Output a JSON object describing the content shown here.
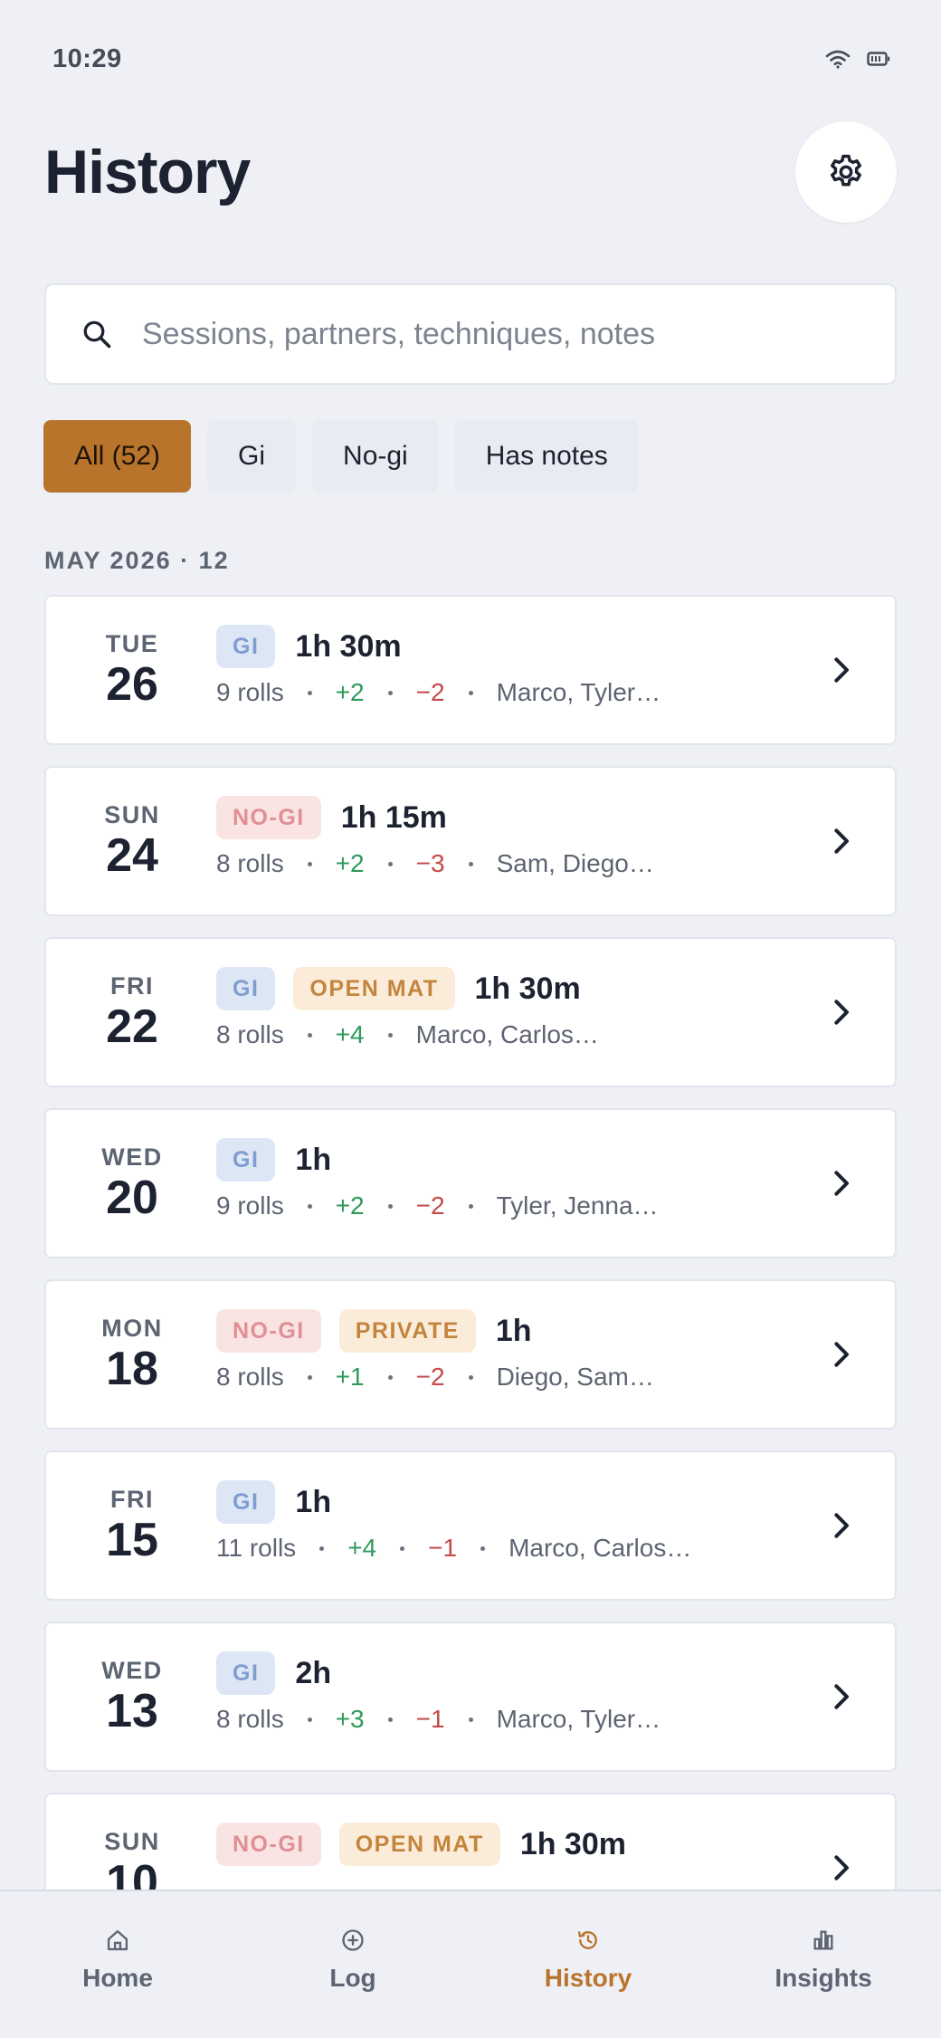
{
  "status": {
    "time": "10:29"
  },
  "header": {
    "title": "History"
  },
  "search": {
    "placeholder": "Sessions, partners, techniques, notes"
  },
  "filters": [
    {
      "label": "All (52)",
      "active": true
    },
    {
      "label": "Gi",
      "active": false
    },
    {
      "label": "No-gi",
      "active": false
    },
    {
      "label": "Has notes",
      "active": false
    }
  ],
  "section": {
    "label": "MAY 2026 · 12"
  },
  "sessions": [
    {
      "dow": "TUE",
      "day": "26",
      "tags": [
        {
          "text": "GI",
          "type": "gi"
        }
      ],
      "duration": "1h 30m",
      "rolls": "9 rolls",
      "wins": "+2",
      "losses": "−2",
      "partners": "Marco, Tyler…"
    },
    {
      "dow": "SUN",
      "day": "24",
      "tags": [
        {
          "text": "NO-GI",
          "type": "nogi"
        }
      ],
      "duration": "1h 15m",
      "rolls": "8 rolls",
      "wins": "+2",
      "losses": "−3",
      "partners": "Sam, Diego…"
    },
    {
      "dow": "FRI",
      "day": "22",
      "tags": [
        {
          "text": "GI",
          "type": "gi"
        },
        {
          "text": "OPEN MAT",
          "type": "open"
        }
      ],
      "duration": "1h 30m",
      "rolls": "8 rolls",
      "wins": "+4",
      "losses": "",
      "partners": "Marco, Carlos…"
    },
    {
      "dow": "WED",
      "day": "20",
      "tags": [
        {
          "text": "GI",
          "type": "gi"
        }
      ],
      "duration": "1h",
      "rolls": "9 rolls",
      "wins": "+2",
      "losses": "−2",
      "partners": "Tyler, Jenna…"
    },
    {
      "dow": "MON",
      "day": "18",
      "tags": [
        {
          "text": "NO-GI",
          "type": "nogi"
        },
        {
          "text": "PRIVATE",
          "type": "private"
        }
      ],
      "duration": "1h",
      "rolls": "8 rolls",
      "wins": "+1",
      "losses": "−2",
      "partners": "Diego, Sam…"
    },
    {
      "dow": "FRI",
      "day": "15",
      "tags": [
        {
          "text": "GI",
          "type": "gi"
        }
      ],
      "duration": "1h",
      "rolls": "11 rolls",
      "wins": "+4",
      "losses": "−1",
      "partners": "Marco, Carlos…"
    },
    {
      "dow": "WED",
      "day": "13",
      "tags": [
        {
          "text": "GI",
          "type": "gi"
        }
      ],
      "duration": "2h",
      "rolls": "8 rolls",
      "wins": "+3",
      "losses": "−1",
      "partners": "Marco, Tyler…"
    },
    {
      "dow": "SUN",
      "day": "10",
      "tags": [
        {
          "text": "NO-GI",
          "type": "nogi"
        },
        {
          "text": "OPEN MAT",
          "type": "open"
        }
      ],
      "duration": "1h 30m",
      "rolls": "",
      "wins": "",
      "losses": "",
      "partners": ""
    }
  ],
  "nav": [
    {
      "label": "Home",
      "icon": "home-icon",
      "active": false
    },
    {
      "label": "Log",
      "icon": "plus-circle-icon",
      "active": false
    },
    {
      "label": "History",
      "icon": "history-icon",
      "active": true
    },
    {
      "label": "Insights",
      "icon": "bar-chart-icon",
      "active": false
    }
  ],
  "colors": {
    "accent": "#b9742c",
    "win": "#2f9a5c",
    "loss": "#c44a4a"
  }
}
